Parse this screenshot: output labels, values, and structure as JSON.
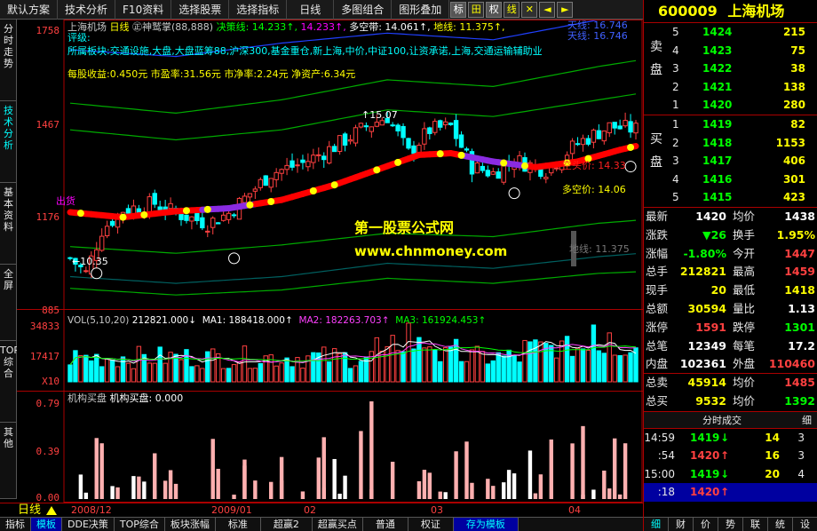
{
  "toolbar": {
    "items": [
      "默认方案",
      "技术分析",
      "F10资料",
      "选择股票",
      "选择指标",
      "日线",
      "多图组合",
      "图形叠加"
    ],
    "squares": [
      "标",
      "田",
      "权",
      "线",
      "✕",
      "◄",
      "►"
    ]
  },
  "left_tabs": [
    "分时走势",
    "技术分析",
    "基本资料",
    "全屏",
    "TOP综合",
    "其他"
  ],
  "chart": {
    "title": "上海机场",
    "period": "日线",
    "indicator": "㊣神鹫掌(88,888)",
    "legend": [
      {
        "label": "决策线: 14.233",
        "color": "#00ff00"
      },
      {
        "label": "14.233",
        "color": "#ff00ff"
      },
      {
        "label": "多空带: 14.061",
        "color": "#ffffff"
      },
      {
        "label": "地线: 11.375",
        "color": "#ffff00"
      }
    ],
    "rating_label": "评级:",
    "sectors": "所属板块:交通设施,大盘,大盘蓝筹88,沪深300,基金重仓,新上海,中价,中证100,让资承诺,上海,交通运输辅助业",
    "eps": "每股收益:0.450元",
    "pe": "市盈率:31.56元",
    "nav_ratio": "市净率:2.24元",
    "nav": "净资产:6.34元",
    "tianxian_top": "天线: 16.746",
    "tianxian": "天线: 16.746",
    "kongjia": "空头价: 14.33",
    "duokong": "多空价: 14.06",
    "dixian": "地线: 11.375",
    "high_mark": "↑15.07",
    "low_mark": "←10.35",
    "sell_mark": "出货",
    "wm_title": "第一股票公式网",
    "wm_url": "www.chnmoney.com",
    "price_ticks": [
      "1758",
      "1467",
      "1176",
      "885"
    ]
  },
  "volume": {
    "header": "VOL(5,10,20)",
    "v1": "212821.000↓",
    "ma1": "MA1: 188418.000↑",
    "ma2": "MA2: 182263.703↑",
    "ma3": "MA3: 161924.453↑",
    "ticks": [
      "34833",
      "17417",
      "X10"
    ]
  },
  "inst": {
    "header": "机构买盘",
    "value": "机构买盘: 0.000",
    "ticks": [
      "0.79",
      "0.39",
      "0.00"
    ]
  },
  "dates": [
    "2008/12",
    "2009/01",
    "02",
    "03",
    "04"
  ],
  "period_label": "日线",
  "bottom_tabs": [
    "指标",
    "模板",
    "DDE决策",
    "TOP综合",
    "板块涨幅",
    "标准",
    "超赢2",
    "超赢买点",
    "普通",
    "权证",
    "存为模板"
  ],
  "quote": {
    "code": "600009",
    "name": "上海机场",
    "sell_label": [
      "卖",
      "盘"
    ],
    "buy_label": [
      "买",
      "盘"
    ],
    "sells": [
      {
        "lvl": "5",
        "price": "1424",
        "vol": "215"
      },
      {
        "lvl": "4",
        "price": "1423",
        "vol": "75"
      },
      {
        "lvl": "3",
        "price": "1422",
        "vol": "38"
      },
      {
        "lvl": "2",
        "price": "1421",
        "vol": "138"
      },
      {
        "lvl": "1",
        "price": "1420",
        "vol": "280"
      }
    ],
    "buys": [
      {
        "lvl": "1",
        "price": "1419",
        "vol": "82"
      },
      {
        "lvl": "2",
        "price": "1418",
        "vol": "1153"
      },
      {
        "lvl": "3",
        "price": "1417",
        "vol": "406"
      },
      {
        "lvl": "4",
        "price": "1416",
        "vol": "301"
      },
      {
        "lvl": "5",
        "price": "1415",
        "vol": "423"
      }
    ],
    "stats": [
      [
        {
          "l": "最新",
          "v": "1420",
          "c": "#ffffff"
        },
        {
          "l": "均价",
          "v": "1438",
          "c": "#ffffff"
        }
      ],
      [
        {
          "l": "涨跌",
          "v": "▼26",
          "c": "#00ff00"
        },
        {
          "l": "换手",
          "v": "1.95%",
          "c": "#ffff00"
        }
      ],
      [
        {
          "l": "涨幅",
          "v": "-1.80%",
          "c": "#00ff00"
        },
        {
          "l": "今开",
          "v": "1447",
          "c": "#ff4040"
        }
      ],
      [
        {
          "l": "总手",
          "v": "212821",
          "c": "#ffff00"
        },
        {
          "l": "最高",
          "v": "1459",
          "c": "#ff4040"
        }
      ],
      [
        {
          "l": "现手",
          "v": "20",
          "c": "#ffff00"
        },
        {
          "l": "最低",
          "v": "1418",
          "c": "#ffff00"
        }
      ],
      [
        {
          "l": "总额",
          "v": "30594",
          "c": "#ffff00"
        },
        {
          "l": "量比",
          "v": "1.13",
          "c": "#ffffff"
        }
      ],
      [
        {
          "l": "涨停",
          "v": "1591",
          "c": "#ff4040"
        },
        {
          "l": "跌停",
          "v": "1301",
          "c": "#00ff00"
        }
      ],
      [
        {
          "l": "总笔",
          "v": "12349",
          "c": "#ffffff"
        },
        {
          "l": "每笔",
          "v": "17.2",
          "c": "#ffffff"
        }
      ],
      [
        {
          "l": "内盘",
          "v": "102361",
          "c": "#ffffff"
        },
        {
          "l": "外盘",
          "v": "110460",
          "c": "#ff4040"
        }
      ],
      [
        {
          "l": "总卖",
          "v": "45914",
          "c": "#ffff00"
        },
        {
          "l": "均价",
          "v": "1485",
          "c": "#ff4040"
        }
      ],
      [
        {
          "l": "总买",
          "v": "9532",
          "c": "#ffff00"
        },
        {
          "l": "均价",
          "v": "1392",
          "c": "#00ff00"
        }
      ]
    ],
    "trades_title": "分时成交",
    "trades_btn": "细",
    "trades": [
      {
        "time": "14:59",
        "price": "1419",
        "dir": "↓",
        "vol": "14",
        "n": "3",
        "c": "#00ff00"
      },
      {
        "time": ":54",
        "price": "1420",
        "dir": "↑",
        "vol": "16",
        "n": "3",
        "c": "#ff4040"
      },
      {
        "time": "15:00",
        "price": "1419",
        "dir": "↓",
        "vol": "20",
        "n": "4",
        "c": "#00ff00"
      },
      {
        "time": ":18",
        "price": "1420",
        "dir": "↑",
        "vol": "",
        "n": "",
        "c": "#ff4040"
      }
    ],
    "bottom_tabs": [
      "细",
      "财",
      "价",
      "势",
      "联",
      "统",
      "设"
    ]
  },
  "colors": {
    "up": "#ff4040",
    "down": "#00ffff",
    "axis": "#aa0000",
    "ma_red": "#ff0000",
    "ma_purple": "#8a2be2",
    "dot": "#ffff00"
  }
}
